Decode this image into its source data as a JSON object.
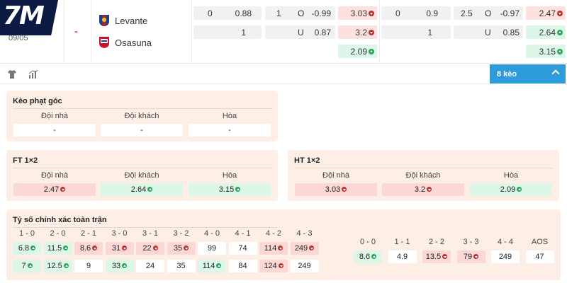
{
  "brand": {
    "logo_text": "7M"
  },
  "match": {
    "date": "09/05",
    "score": "-",
    "home": {
      "name": "Levante",
      "crest": "levante-crest-icon"
    },
    "away": {
      "name": "Osasuna",
      "crest": "osasuna-crest-icon"
    }
  },
  "ft_odds": {
    "handicap": {
      "line": "0",
      "home": "0.88",
      "away_line": "",
      "away": "1"
    },
    "over_under": {
      "line": "1",
      "over_label": "O",
      "over": "-0.99",
      "under_label": "U",
      "under": "0.87"
    },
    "x12": {
      "home": "3.03",
      "away": "3.2",
      "draw": "2.09"
    }
  },
  "ht_odds": {
    "handicap": {
      "line": "0",
      "home": "0.9",
      "away": "1"
    },
    "over_under": {
      "line": "2.5",
      "over_label": "O",
      "over": "-0.97",
      "under_label": "U",
      "under": "0.85"
    },
    "x12": {
      "home": "2.47",
      "away": "2.64",
      "draw": "3.15"
    }
  },
  "toolbar": {
    "shirt_icon": "shirt-icon",
    "stats_icon": "stats-icon",
    "more_label": "8 kèo"
  },
  "corner": {
    "title": "Kèo phạt góc",
    "cols": [
      "Đội nhà",
      "Đội khách",
      "Hòa"
    ],
    "values": [
      "-",
      "-",
      "-"
    ]
  },
  "ft_1x2": {
    "title": "FT 1×2",
    "cols": [
      "Đội nhà",
      "Đội khách",
      "Hòa"
    ],
    "values": [
      "2.47",
      "2.64",
      "3.15"
    ]
  },
  "ht_1x2": {
    "title": "HT 1×2",
    "cols": [
      "Đội nhà",
      "Đội khách",
      "Hòa"
    ],
    "values": [
      "3.03",
      "3.2",
      "2.09"
    ]
  },
  "correct_score": {
    "title": "Tỷ số chính xác toàn trận",
    "home_labels": [
      "1 - 0",
      "2 - 0",
      "2 - 1",
      "3 - 0",
      "3 - 1",
      "3 - 2",
      "4 - 0",
      "4 - 1",
      "4 - 2",
      "4 - 3"
    ],
    "home_row1": [
      "6.8",
      "11.5",
      "8.6",
      "31",
      "22",
      "35",
      "99",
      "74",
      "114",
      "249"
    ],
    "home_row2": [
      "7",
      "12.5",
      "9",
      "33",
      "24",
      "35",
      "114",
      "84",
      "124",
      "249"
    ],
    "draw_labels": [
      "0 - 0",
      "1 - 1",
      "2 - 2",
      "3 - 3",
      "4 - 4",
      "AOS"
    ],
    "draw_row1": [
      "8.6",
      "4.9",
      "13.5",
      "79",
      "249",
      "47"
    ]
  },
  "colors": {
    "accent": "#2e9bdb",
    "panel": "#fdeee6",
    "red": "#fbd8d5",
    "green": "#dcf7e7",
    "up": "#29a35a",
    "down": "#b8312f"
  }
}
